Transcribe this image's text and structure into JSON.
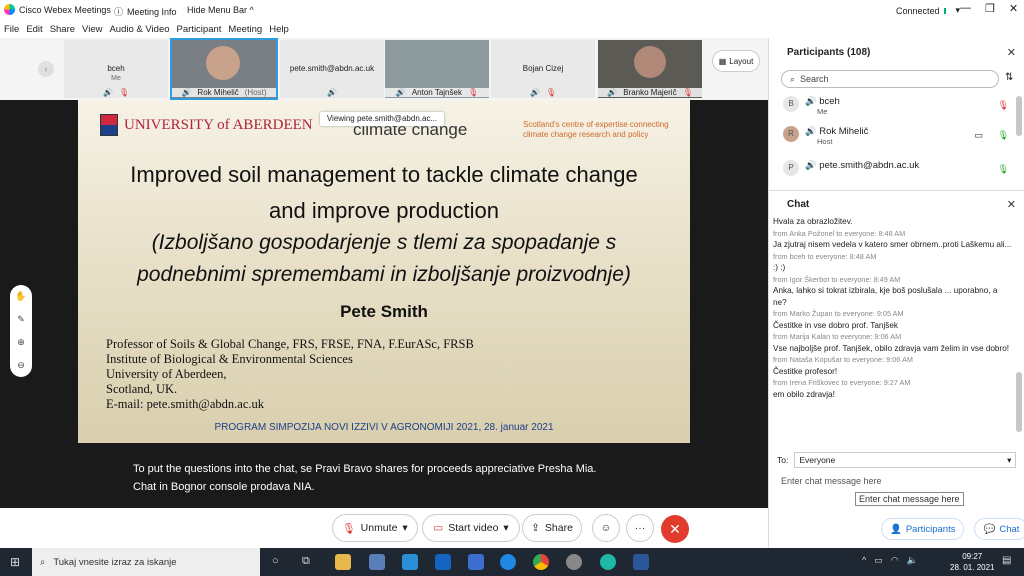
{
  "titlebar": {
    "app_name": "Cisco Webex Meetings",
    "meeting_info": "Meeting Info",
    "hide_menu_bar": "Hide Menu Bar ^",
    "connection": "Connected",
    "min": "—",
    "max": "❐",
    "close": "✕"
  },
  "menu": [
    "File",
    "Edit",
    "Share",
    "View",
    "Audio & Video",
    "Participant",
    "Meeting",
    "Help"
  ],
  "video_tiles": [
    {
      "name": "bceh",
      "sub": "Me"
    },
    {
      "name": "Rok Mihelič",
      "sub": "(Host)"
    },
    {
      "name": "pete.smith@abdn.ac.uk",
      "sub": ""
    },
    {
      "name": "Anton Tajnšek",
      "sub": ""
    },
    {
      "name": "Bojan Cizej",
      "sub": ""
    },
    {
      "name": "Branko Majerič",
      "sub": ""
    }
  ],
  "layout_label": "Layout",
  "viewing_banner": "Viewing pete.smith@abdn.ac...",
  "slide": {
    "university": "UNIVERSITY of ABERDEEN",
    "climate": "climate change",
    "tagline": "Scotland's centre of expertise connecting climate change research and policy",
    "title1": "Improved soil management to tackle climate change",
    "title2": "and improve production",
    "title3": "(Izboljšano gospodarjenje s tlemi za spopadanje s",
    "title4": "podnebnimi spremembami in izboljšanje proizvodnje)",
    "author": "Pete Smith",
    "aff1": "Professor of Soils & Global Change, FRS, FRSE, FNA, F.EurASc, FRSB",
    "aff2": "Institute of Biological & Environmental Sciences",
    "aff3": "University of Aberdeen,",
    "aff4": "Scotland, UK.",
    "aff5": "E-mail: pete.smith@abdn.ac.uk",
    "program": "PROGRAM SIMPOZIJA NOVI IZZIVI V AGRONOMIJI 2021, 28. januar 2021"
  },
  "caption1": "To put the questions into the chat, se Pravi Bravo shares for proceeds appreciative Presha Mia.",
  "caption2": "Chat in Bognor console prodava NIA.",
  "controls": {
    "unmute": "Unmute",
    "start_video": "Start video",
    "share": "Share"
  },
  "participants": {
    "header": "Participants (108)",
    "search_placeholder": "Search",
    "list": [
      {
        "initial": "B",
        "name": "bceh",
        "sub": "Me"
      },
      {
        "initial": "R",
        "name": "Rok Mihelič",
        "sub": "Host"
      },
      {
        "initial": "P",
        "name": "pete.smith@abdn.ac.uk",
        "sub": ""
      }
    ]
  },
  "chat": {
    "header": "Chat",
    "messages": [
      {
        "from": "",
        "text": "Hvala za obrazložitev."
      },
      {
        "from": "from Anka Požonel to everyone:    8:48 AM",
        "text": "Ja zjutraj nisem vedela v katero smer obrnem..proti Laškemu ali..."
      },
      {
        "from": "from bceh to everyone:    8:48 AM",
        "text": ":) :)"
      },
      {
        "from": "from Igor Škerbot to everyone:    8:49 AM",
        "text": "Anka, lahko si tokrat izbirala, kje boš poslušala ... uporabno, a ne?"
      },
      {
        "from": "from Marko Župan to everyone:    9:05 AM",
        "text": "Čestitke in vse dobro prof. Tanjšek"
      },
      {
        "from": "from Marija Kalan to everyone:    9:06 AM",
        "text": "Vse najboljše prof. Tanjšek, obilo zdravja vam želim in vse dobro!"
      },
      {
        "from": "from Nataša Kopušar to everyone:    9:06 AM",
        "text": "Čestitke profesor!"
      },
      {
        "from": "from Irena Friškovec to everyone:    9:27 AM",
        "text": "em obilo zdravja!"
      }
    ],
    "to_label": "To:",
    "to_value": "Everyone",
    "input_placeholder": "Enter chat message here",
    "tooltip": "Enter chat message here"
  },
  "tabs": {
    "participants": "Participants",
    "chat": "Chat"
  },
  "taskbar": {
    "search": "Tukaj vnesite izraz za iskanje",
    "time": "09:27",
    "date": "28. 01. 2021"
  }
}
